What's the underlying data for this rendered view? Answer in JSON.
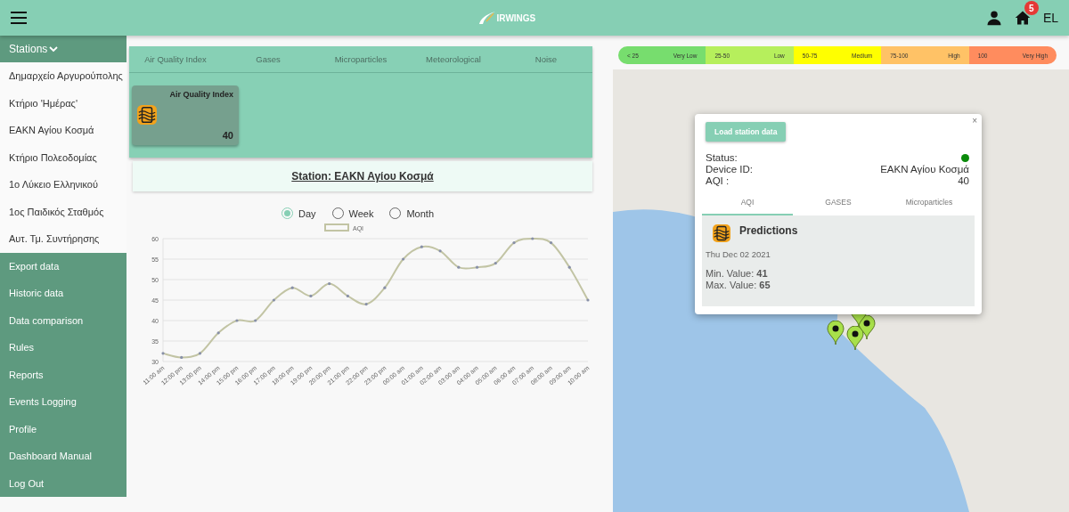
{
  "header": {
    "logo_text": "IRWINGS",
    "notifications": "5",
    "language": "EL"
  },
  "sidebar": {
    "stations_label": "Stations",
    "stations": [
      "Δημαρχείο Αργυρούπολης",
      "Κτήριο 'Ημέρας'",
      "ΕΑΚΝ Αγίου Κοσμά",
      "Κτήριο Πολεοδομίας",
      "1ο Λύκειο Ελληνικού",
      "1ος Παιδικός Σταθμός",
      "Αυτ. Τμ. Συντήρησης"
    ],
    "menu": [
      "Export data",
      "Historic data",
      "Data comparison",
      "Rules",
      "Reports",
      "Events Logging",
      "Profile",
      "Dashboard Manual",
      "Log Out"
    ]
  },
  "category_tabs": [
    "Air Quality Index",
    "Gases",
    "Microparticles",
    "Meteorological",
    "Noise"
  ],
  "aqi_card": {
    "title": "Air Quality Index",
    "value": "40"
  },
  "station_title": "Station: ΕΑΚΝ Αγίου Κοσμά",
  "period": [
    {
      "label": "Day",
      "selected": true
    },
    {
      "label": "Week",
      "selected": false
    },
    {
      "label": "Month",
      "selected": false
    }
  ],
  "chart_data": {
    "type": "line",
    "categories": [
      "11:00 am",
      "12:00 pm",
      "13:00 pm",
      "14:00 pm",
      "15:00 pm",
      "16:00 pm",
      "17:00 pm",
      "18:00 pm",
      "19:00 pm",
      "20:00 pm",
      "21:00 pm",
      "22:00 pm",
      "23:00 pm",
      "00:00 am",
      "01:00 am",
      "02:00 am",
      "03:00 am",
      "04:00 am",
      "05:00 am",
      "06:00 am",
      "07:00 am",
      "08:00 am",
      "09:00 am",
      "10:00 am"
    ],
    "series": [
      {
        "name": "AQI",
        "color": "#c2c4a4",
        "values": [
          32,
          31,
          32,
          37,
          40,
          40,
          45,
          48,
          46,
          49,
          46,
          44,
          48,
          55,
          58,
          57,
          53,
          53,
          54,
          59,
          60,
          59,
          53,
          45
        ]
      }
    ],
    "ylim": [
      30,
      60
    ],
    "grid": true,
    "yticks": [
      30,
      35,
      40,
      45,
      50,
      55,
      60
    ]
  },
  "legend": [
    {
      "range": "< 25",
      "label": "Very Low",
      "color": "#77dd6e"
    },
    {
      "range": "25-50",
      "label": "Low",
      "color": "#b6ef5c"
    },
    {
      "range": "50-75",
      "label": "Medium",
      "color": "#ffff00"
    },
    {
      "range": "75-100",
      "label": "High",
      "color": "#ffc266"
    },
    {
      "range": "100",
      "label": "Very High",
      "color": "#ff8c5e"
    }
  ],
  "popup": {
    "button": "Load station data",
    "status_label": "Status:",
    "status_online": true,
    "device_label": "Device ID:",
    "device_value": "ΕΑΚΝ Αγίου Κοσμά",
    "aqi_label": "AQI :",
    "aqi_value": "40",
    "tabs": [
      {
        "label": "AQI",
        "selected": true
      },
      {
        "label": "GASES",
        "selected": false
      },
      {
        "label": "Microparticles",
        "selected": false
      }
    ],
    "predictions_title": "Predictions",
    "date": "Thu Dec 02 2021",
    "min_text": "Min. Value: **41**",
    "max_text": "Max. Value: **65**",
    "close": "×"
  }
}
